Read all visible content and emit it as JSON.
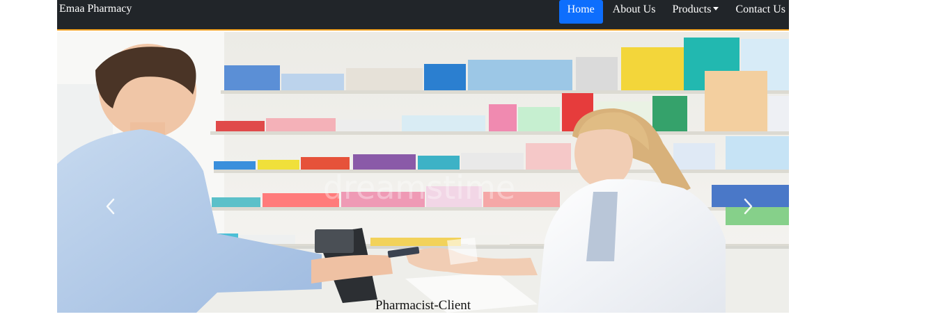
{
  "brand": "Emaa Pharmacy",
  "nav": {
    "home": "Home",
    "about": "About Us",
    "products": "Products",
    "contact": "Contact Us"
  },
  "carousel": {
    "caption": "Pharmacist-Client",
    "watermark": "dreamstime",
    "prev_icon": "chevron-left-icon",
    "next_icon": "chevron-right-icon"
  },
  "colors": {
    "navbar_bg": "#212529",
    "navbar_accent": "#f0a020",
    "active_link": "#0d6efd"
  }
}
